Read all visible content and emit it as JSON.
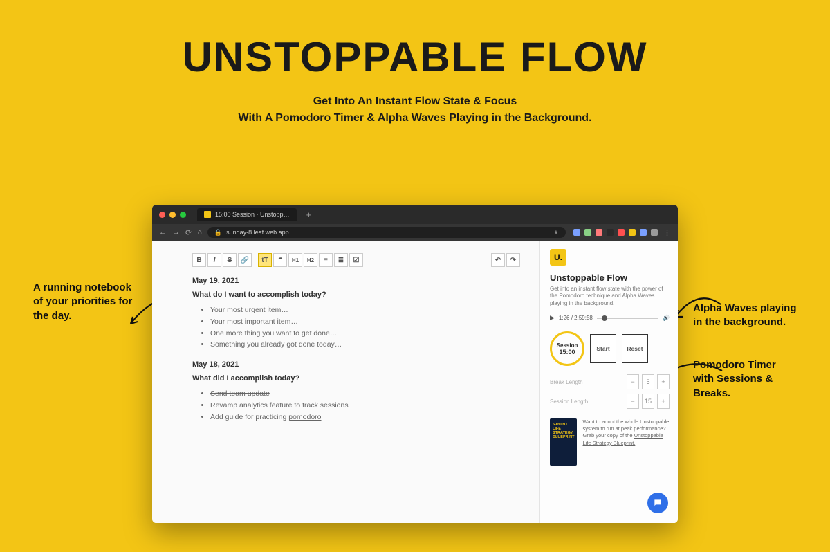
{
  "hero": {
    "title": "UNSTOPPABLE FLOW",
    "sub1": "Get Into An Instant Flow State & Focus",
    "sub2": "With A Pomodoro Timer & Alpha Waves Playing in the Background."
  },
  "annotations": {
    "left": "A running notebook of your priorities for the day.",
    "right1": "Alpha Waves playing in the background.",
    "right2": "Pomodoro Timer with Sessions & Breaks."
  },
  "browser": {
    "tab_title": "15:00 Session · Unstopp…",
    "url": "sunday-8.leaf.web.app",
    "ext_colors": [
      "#7aa0ff",
      "#89d185",
      "#ff7a7a",
      "#2a2a2a",
      "#ff5050",
      "#f3c515",
      "#7aa0ff",
      "#9b9b9b"
    ]
  },
  "toolbar": {
    "bold": "B",
    "italic": "I",
    "strike": "S",
    "link": "🔗",
    "tt": "tT",
    "quote": "❝",
    "h1": "H1",
    "h2": "H2",
    "ul": "≡",
    "ol": "≣",
    "check": "☑",
    "undo": "↶",
    "redo": "↷"
  },
  "note": {
    "entries": [
      {
        "date": "May 19, 2021",
        "question": "What do I want to accomplish today?",
        "items": [
          {
            "text": "Your most urgent item…",
            "strike": false
          },
          {
            "text": "Your most important item…",
            "strike": false
          },
          {
            "text": "One more thing you want to get done…",
            "strike": false
          },
          {
            "text": "Something you already got done today…",
            "strike": false
          }
        ]
      },
      {
        "date": "May 18, 2021",
        "question": "What did I accomplish today?",
        "items": [
          {
            "text": "Send team update",
            "strike": true
          },
          {
            "text": "Revamp analytics feature to track sessions",
            "strike": false
          },
          {
            "text_prefix": "Add guide for practicing ",
            "link": "pomodoro",
            "strike": false
          }
        ]
      }
    ]
  },
  "sidebar": {
    "logo": "U.",
    "title": "Unstoppable Flow",
    "desc": "Get into an instant flow state with the power of the Pomodoro technique and Alpha Waves playing in the background.",
    "player": {
      "play": "▶",
      "time": "1:26 / 2:59:58",
      "vol": "🔊"
    },
    "session_label": "Session",
    "session_time": "15:00",
    "start": "Start",
    "reset": "Reset",
    "break_label": "Break Length",
    "session_len_label": "Session Length",
    "minus": "−",
    "plus": "+",
    "break_val": "5",
    "session_val": "15",
    "promo_text": "Want to adopt the whole Unstoppable system to run at peak performance? Grab your copy of the ",
    "promo_link": "Unstoppable Life Strategy Blueprint.",
    "book_line1": "5-POINT",
    "book_line2": "LIFE STRATEGY",
    "book_line3": "BLUEPRINT"
  }
}
